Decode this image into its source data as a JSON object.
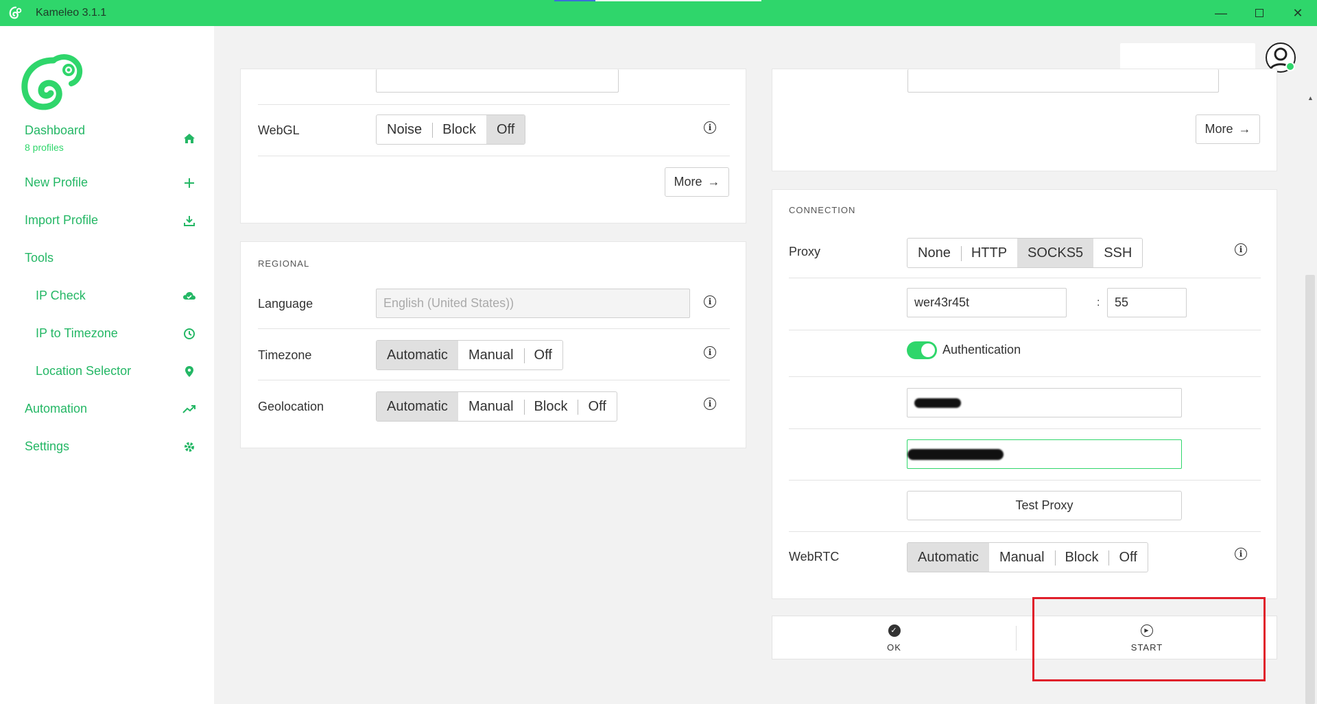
{
  "window": {
    "title": "Kameleo 3.1.1",
    "progress": 0.2
  },
  "sidebar": {
    "dashboard": {
      "label": "Dashboard",
      "sub": "8 profiles"
    },
    "items": [
      {
        "label": "New Profile",
        "icon": "plus-icon"
      },
      {
        "label": "Import Profile",
        "icon": "download-icon"
      },
      {
        "label": "Tools",
        "icon": ""
      },
      {
        "label": "IP Check",
        "icon": "cloud-icon"
      },
      {
        "label": "IP to Timezone",
        "icon": "clock-icon"
      },
      {
        "label": "Location Selector",
        "icon": "map-pin-icon"
      },
      {
        "label": "Automation",
        "icon": "trending-up-icon"
      },
      {
        "label": "Settings",
        "icon": "gear-icon"
      }
    ]
  },
  "left": {
    "webgl": {
      "label": "WebGL",
      "options": [
        "Noise",
        "Block",
        "Off"
      ],
      "selected": "Off"
    },
    "more_label": "More",
    "regional": {
      "title": "REGIONAL",
      "language": {
        "label": "Language",
        "placeholder": "English (United States))"
      },
      "timezone": {
        "label": "Timezone",
        "options": [
          "Automatic",
          "Manual",
          "Off"
        ],
        "selected": "Automatic"
      },
      "geolocation": {
        "label": "Geolocation",
        "options": [
          "Automatic",
          "Manual",
          "Block",
          "Off"
        ],
        "selected": "Automatic"
      }
    }
  },
  "right": {
    "more_label": "More",
    "connection": {
      "title": "CONNECTION",
      "proxy": {
        "label": "Proxy",
        "options": [
          "None",
          "HTTP",
          "SOCKS5",
          "SSH"
        ],
        "selected": "SOCKS5"
      },
      "host": "wer43r45t",
      "separator": ":",
      "port": "55",
      "authentication_label": "Authentication",
      "authentication_on": true,
      "test_proxy_label": "Test Proxy",
      "webrtc": {
        "label": "WebRTC",
        "options": [
          "Automatic",
          "Manual",
          "Block",
          "Off"
        ],
        "selected": "Automatic"
      }
    }
  },
  "actions": {
    "ok": "OK",
    "start": "START"
  },
  "colors": {
    "accent": "#2fd66b",
    "accent_text": "#24b765",
    "highlight": "#e01e2a"
  }
}
